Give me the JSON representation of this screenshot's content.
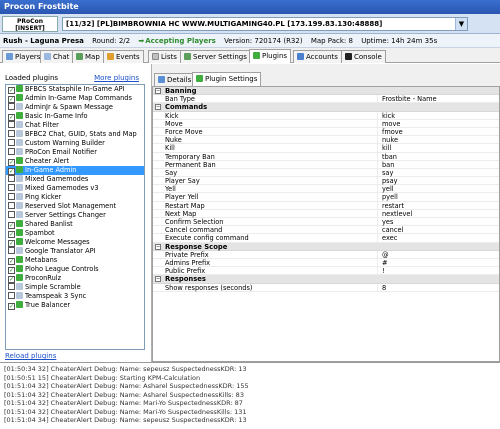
{
  "window": {
    "title": "Procon Frostbite"
  },
  "server": {
    "logo_line1": "PRoCon",
    "logo_line2": "[INSERT]",
    "selected": "[11/32] [PL]BIMBROWNIA HC WWW.MULTIGAMING40.PL [173.199.83.130:48888]"
  },
  "status": {
    "mode_map": "Rush - Laguna Presa",
    "round": "Round: 2/2",
    "state": "Accepting Players",
    "version": "Version: 720174 (R32)",
    "map_pack": "Map Pack: 8",
    "uptime": "Uptime: 14h 24m 35s"
  },
  "main_tabs": [
    {
      "label": "Players",
      "icon": "players-icon"
    },
    {
      "label": "Chat",
      "icon": "chat-icon"
    },
    {
      "label": "Map",
      "icon": "map-icon"
    },
    {
      "label": "Events",
      "icon": "events-icon"
    },
    {
      "label": "Lists",
      "icon": "lists-icon"
    },
    {
      "label": "Server Settings",
      "icon": "server-settings-icon"
    },
    {
      "label": "Plugins",
      "icon": "plugins-icon"
    },
    {
      "label": "Accounts",
      "icon": "accounts-icon"
    },
    {
      "label": "Console",
      "icon": "console-icon"
    }
  ],
  "plugins": {
    "loaded_label": "Loaded plugins",
    "more_label": "More plugins",
    "reload_label": "Reload plugins",
    "items": [
      {
        "label": "BFBCS Statsphile In-Game API",
        "checked": true
      },
      {
        "label": "Admin In-Game Map Commands",
        "checked": true
      },
      {
        "label": "AdminJr & Spawn Message",
        "checked": false
      },
      {
        "label": "Basic In-Game Info",
        "checked": true
      },
      {
        "label": "Chat Filter",
        "checked": false
      },
      {
        "label": "BFBC2 Chat, GUID, Stats and Map",
        "checked": false
      },
      {
        "label": "Custom Warning Builder",
        "checked": false
      },
      {
        "label": "PRoCon Email Notifier",
        "checked": false
      },
      {
        "label": "Cheater Alert",
        "checked": true
      },
      {
        "label": "In-Game Admin",
        "checked": true
      },
      {
        "label": "Mixed Gamemodes",
        "checked": false
      },
      {
        "label": "Mixed Gamemodes v3",
        "checked": false
      },
      {
        "label": "Ping Kicker",
        "checked": false
      },
      {
        "label": "Reserved Slot Management",
        "checked": false
      },
      {
        "label": "Server Settings Changer",
        "checked": false
      },
      {
        "label": "Shared Banlist",
        "checked": true
      },
      {
        "label": "Spambot",
        "checked": true
      },
      {
        "label": "Welcome Messages",
        "checked": true
      },
      {
        "label": "Google Translator API",
        "checked": false
      },
      {
        "label": "Metabans",
        "checked": true
      },
      {
        "label": "Ploho League Controls",
        "checked": true
      },
      {
        "label": "ProconRulz",
        "checked": true
      },
      {
        "label": "Simple Scramble",
        "checked": false
      },
      {
        "label": "Teamspeak 3 Sync",
        "checked": false
      },
      {
        "label": "True Balancer",
        "checked": true
      }
    ],
    "selected_index": 9
  },
  "sub_tabs": [
    {
      "label": "Details",
      "icon": "details-icon"
    },
    {
      "label": "Plugin Settings",
      "icon": "plugin-settings-icon"
    }
  ],
  "grid": [
    {
      "type": "cat",
      "name": "Banning"
    },
    {
      "type": "row",
      "name": "Ban Type",
      "value": "Frostbite - Name"
    },
    {
      "type": "cat",
      "name": "Commands"
    },
    {
      "type": "row",
      "name": "Kick",
      "value": "kick"
    },
    {
      "type": "row",
      "name": "Move",
      "value": "move"
    },
    {
      "type": "row",
      "name": "Force Move",
      "value": "fmove"
    },
    {
      "type": "row",
      "name": "Nuke",
      "value": "nuke"
    },
    {
      "type": "row",
      "name": "Kill",
      "value": "kill"
    },
    {
      "type": "row",
      "name": "Temporary Ban",
      "value": "tban"
    },
    {
      "type": "row",
      "name": "Permanent Ban",
      "value": "ban"
    },
    {
      "type": "row",
      "name": "Say",
      "value": "say"
    },
    {
      "type": "row",
      "name": "Player Say",
      "value": "psay"
    },
    {
      "type": "row",
      "name": "Yell",
      "value": "yell"
    },
    {
      "type": "row",
      "name": "Player Yell",
      "value": "pyell"
    },
    {
      "type": "row",
      "name": "Restart Map",
      "value": "restart"
    },
    {
      "type": "row",
      "name": "Next Map",
      "value": "nextlevel"
    },
    {
      "type": "row",
      "name": "Confirm Selection",
      "value": "yes"
    },
    {
      "type": "row",
      "name": "Cancel command",
      "value": "cancel"
    },
    {
      "type": "row",
      "name": "Execute config command",
      "value": "exec"
    },
    {
      "type": "cat",
      "name": "Response Scope"
    },
    {
      "type": "row",
      "name": "Private Prefix",
      "value": "@"
    },
    {
      "type": "row",
      "name": "Admins Prefix",
      "value": "#"
    },
    {
      "type": "row",
      "name": "Public Prefix",
      "value": "!"
    },
    {
      "type": "cat",
      "name": "Responses"
    },
    {
      "type": "row",
      "name": "Show responses (seconds)",
      "value": "8"
    }
  ],
  "console": {
    "lines": [
      "[01:50:34 32] CheaterAlert Debug: Name: sepeusz SuspectednessKDR: 13",
      "[01:50:51 15] CheaterAlert Debug: Starting KPM-Calculation",
      "[01:51:04 32] CheaterAlert Debug: Name: Asharel SuspectednessKDR: 155",
      "[01:51:04 32] CheaterAlert Debug: Name: Asharel SuspectednessKills: 83",
      "[01:51:04 32] CheaterAlert Debug: Name: Mari-Yo SuspectednessKDR: 87",
      "[01:51:04 32] CheaterAlert Debug: Name: Mari-Yo SuspectednessKills: 131",
      "[01:51:04 34] CheaterAlert Debug: Name: sepeusz SuspectednessKDR: 13"
    ]
  },
  "colors": {
    "accent": "#3399ff",
    "titlebar": "#2a55b0",
    "state_green": "#2e8b2e",
    "link": "#1c50c8"
  }
}
